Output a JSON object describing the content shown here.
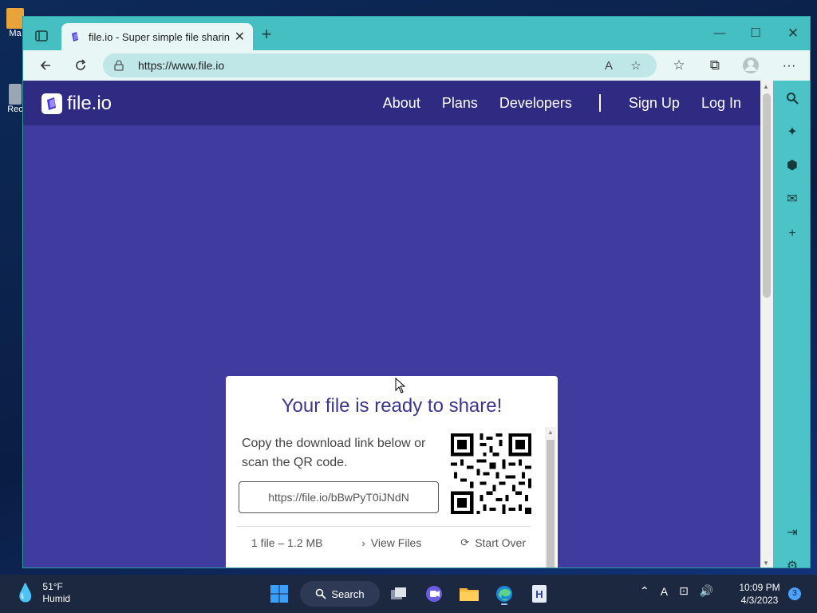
{
  "desktop": {
    "icon1_label": "Ma",
    "icon2_label": "Rec"
  },
  "browser": {
    "tab_title": "file.io - Super simple file sharing",
    "url": "https://www.file.io",
    "colors": {
      "frame": "#4cc3c7",
      "toolbar": "#e9f6f6",
      "address": "#bfe7e8"
    }
  },
  "site": {
    "logo_text": "file.io",
    "nav": {
      "about": "About",
      "plans": "Plans",
      "developers": "Developers",
      "sign_up": "Sign Up",
      "log_in": "Log In"
    },
    "colors": {
      "header": "#2f2a82",
      "background": "#3f3b9f",
      "accent": "#3a368f"
    }
  },
  "card": {
    "title": "Your file is ready to share!",
    "description": "Copy the download link below or scan the QR code.",
    "link": "https://file.io/bBwPyT0iJNdN",
    "file_info": "1 file – 1.2 MB",
    "view_files": "View Files",
    "start_over": "Start Over"
  },
  "taskbar": {
    "weather_temp": "51°F",
    "weather_desc": "Humid",
    "search_label": "Search",
    "time": "10:09 PM",
    "date": "4/3/2023",
    "notification_count": "3",
    "ime": "A"
  }
}
